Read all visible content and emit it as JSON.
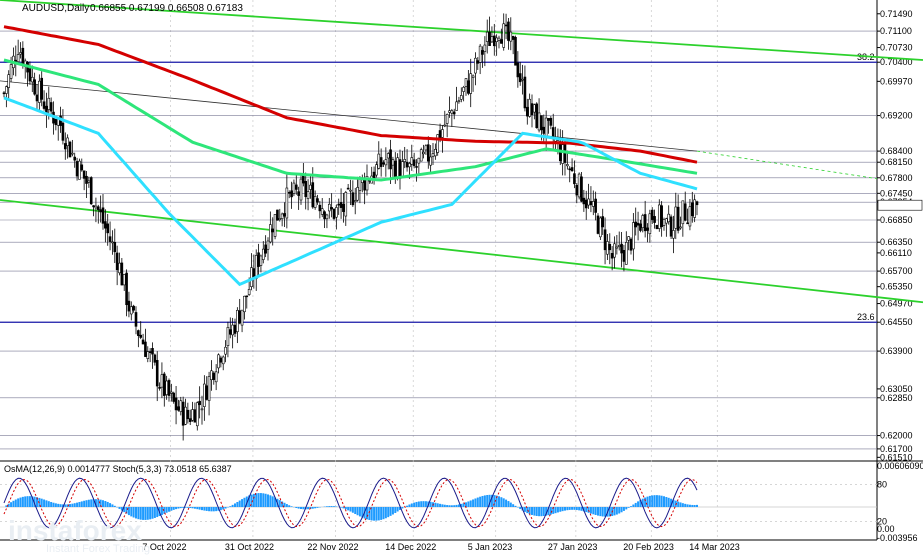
{
  "header": {
    "symbol": "AUDUSD,Daily",
    "ohlc": "0.66855 0.67199 0.66508 0.67183"
  },
  "oscillator": {
    "label": "OsMA(12,26,9) 0.0014777  Stoch(5,3,3) 73.0518 65.6387",
    "scale_labels": [
      "0.00606090",
      "80",
      "20",
      "0.00",
      "-0.003956"
    ]
  },
  "brand": {
    "name": "instaforex",
    "tagline": "Instant Forex Trading"
  },
  "colors": {
    "bull_candle": "#000000",
    "bear_candle": "#000000",
    "ema_red": "#d40000",
    "ema_green": "#2ee67a",
    "ema_cyan": "#2fe0ff",
    "channel": "#2cd12c",
    "fibo_line": "#1a1aa8",
    "grid": "#c8c8c8",
    "osma_bar": "#1e9bff"
  },
  "chart_data": {
    "type": "candlestick",
    "symbol": "AUDUSD",
    "timeframe": "Daily",
    "ylim": [
      0.6145,
      0.718
    ],
    "x_tick_labels": [
      "7 Oct 2022",
      "31 Oct 2022",
      "22 Nov 2022",
      "14 Dec 2022",
      "5 Jan 2023",
      "27 Jan 2023",
      "20 Feb 2023",
      "14 Mar 2023"
    ],
    "price_axis_labels": [
      "0.71490",
      "0.71100",
      "0.70730",
      "0.70400",
      "0.69970",
      "0.69200",
      "0.68400",
      "0.68150",
      "0.67800",
      "0.67450",
      "0.67254",
      "0.66850",
      "0.66350",
      "0.66110",
      "0.65700",
      "0.65350",
      "0.64970",
      "0.64550",
      "0.63900",
      "0.63050",
      "0.62850",
      "0.62000",
      "0.61700",
      "0.61510"
    ],
    "horizontal_levels": [
      0.711,
      0.704,
      0.692,
      0.684,
      0.6815,
      0.678,
      0.6745,
      0.6725,
      0.6685,
      0.6635,
      0.657,
      0.6455,
      0.639,
      0.6285,
      0.62,
      0.617
    ],
    "fibonacci": [
      {
        "label": "38.2",
        "price": 0.704
      },
      {
        "label": "23.6",
        "price": 0.6455
      }
    ],
    "current_price": 0.67183,
    "close_path": [
      [
        0,
        0.697
      ],
      [
        6,
        0.708
      ],
      [
        12,
        0.7
      ],
      [
        18,
        0.694
      ],
      [
        24,
        0.69
      ],
      [
        30,
        0.682
      ],
      [
        36,
        0.676
      ],
      [
        42,
        0.668
      ],
      [
        48,
        0.66
      ],
      [
        54,
        0.647
      ],
      [
        60,
        0.64
      ],
      [
        66,
        0.632
      ],
      [
        72,
        0.627
      ],
      [
        78,
        0.624
      ],
      [
        84,
        0.628
      ],
      [
        90,
        0.637
      ],
      [
        96,
        0.643
      ],
      [
        102,
        0.65
      ],
      [
        108,
        0.66
      ],
      [
        114,
        0.668
      ],
      [
        120,
        0.673
      ],
      [
        126,
        0.675
      ],
      [
        132,
        0.674
      ],
      [
        138,
        0.67
      ],
      [
        144,
        0.671
      ],
      [
        150,
        0.676
      ],
      [
        156,
        0.679
      ],
      [
        162,
        0.682
      ],
      [
        168,
        0.68
      ],
      [
        174,
        0.68
      ],
      [
        180,
        0.683
      ],
      [
        186,
        0.689
      ],
      [
        192,
        0.695
      ],
      [
        198,
        0.7
      ],
      [
        204,
        0.708
      ],
      [
        210,
        0.712
      ],
      [
        216,
        0.707
      ],
      [
        222,
        0.694
      ],
      [
        228,
        0.69
      ],
      [
        234,
        0.686
      ],
      [
        240,
        0.68
      ],
      [
        246,
        0.674
      ],
      [
        252,
        0.668
      ],
      [
        258,
        0.66
      ],
      [
        264,
        0.662
      ],
      [
        270,
        0.668
      ],
      [
        276,
        0.67
      ],
      [
        282,
        0.667
      ],
      [
        288,
        0.67
      ],
      [
        294,
        0.672
      ]
    ],
    "ema_red": [
      [
        0,
        0.712
      ],
      [
        40,
        0.708
      ],
      [
        80,
        0.7
      ],
      [
        120,
        0.6915
      ],
      [
        160,
        0.6875
      ],
      [
        200,
        0.6862
      ],
      [
        240,
        0.6858
      ],
      [
        270,
        0.684
      ],
      [
        294,
        0.6815
      ]
    ],
    "ema_green": [
      [
        0,
        0.7045
      ],
      [
        40,
        0.699
      ],
      [
        80,
        0.686
      ],
      [
        120,
        0.679
      ],
      [
        160,
        0.6775
      ],
      [
        200,
        0.6805
      ],
      [
        230,
        0.6845
      ],
      [
        260,
        0.682
      ],
      [
        294,
        0.679
      ]
    ],
    "ema_cyan": [
      [
        0,
        0.696
      ],
      [
        40,
        0.688
      ],
      [
        70,
        0.67
      ],
      [
        100,
        0.654
      ],
      [
        130,
        0.661
      ],
      [
        160,
        0.668
      ],
      [
        190,
        0.672
      ],
      [
        220,
        0.688
      ],
      [
        245,
        0.686
      ],
      [
        270,
        0.679
      ],
      [
        294,
        0.6755
      ]
    ],
    "channel_upper": [
      [
        0.718,
        0
      ],
      [
        0.7045,
        923
      ]
    ],
    "channel_lower": [
      [
        0.673,
        0
      ],
      [
        0.65,
        923
      ]
    ],
    "stoch_levels": [
      20,
      80
    ]
  }
}
